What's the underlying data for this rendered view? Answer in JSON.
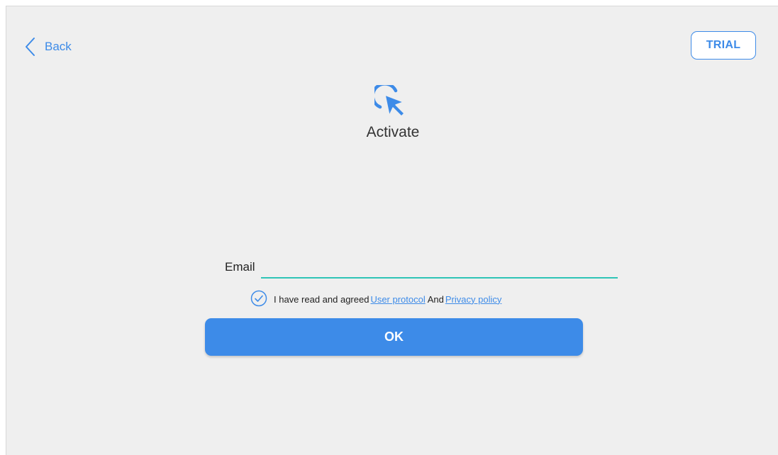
{
  "header": {
    "back_label": "Back",
    "back_icon": "chevron-left-icon",
    "trial_label": "TRIAL"
  },
  "main": {
    "logo_icon": "cursor-click-icon",
    "title": "Activate"
  },
  "form": {
    "email_label": "Email",
    "email_value": "",
    "agreement": {
      "checked": true,
      "check_icon": "check-circle-icon",
      "prefix": "I have read and agreed",
      "user_protocol_link": "User protocol",
      "conjunction": "And",
      "privacy_policy_link": "Privacy policy"
    },
    "ok_label": "OK"
  },
  "colors": {
    "accent": "#3d8be8",
    "input_underline": "#2ec4b6",
    "background": "#efefef"
  }
}
